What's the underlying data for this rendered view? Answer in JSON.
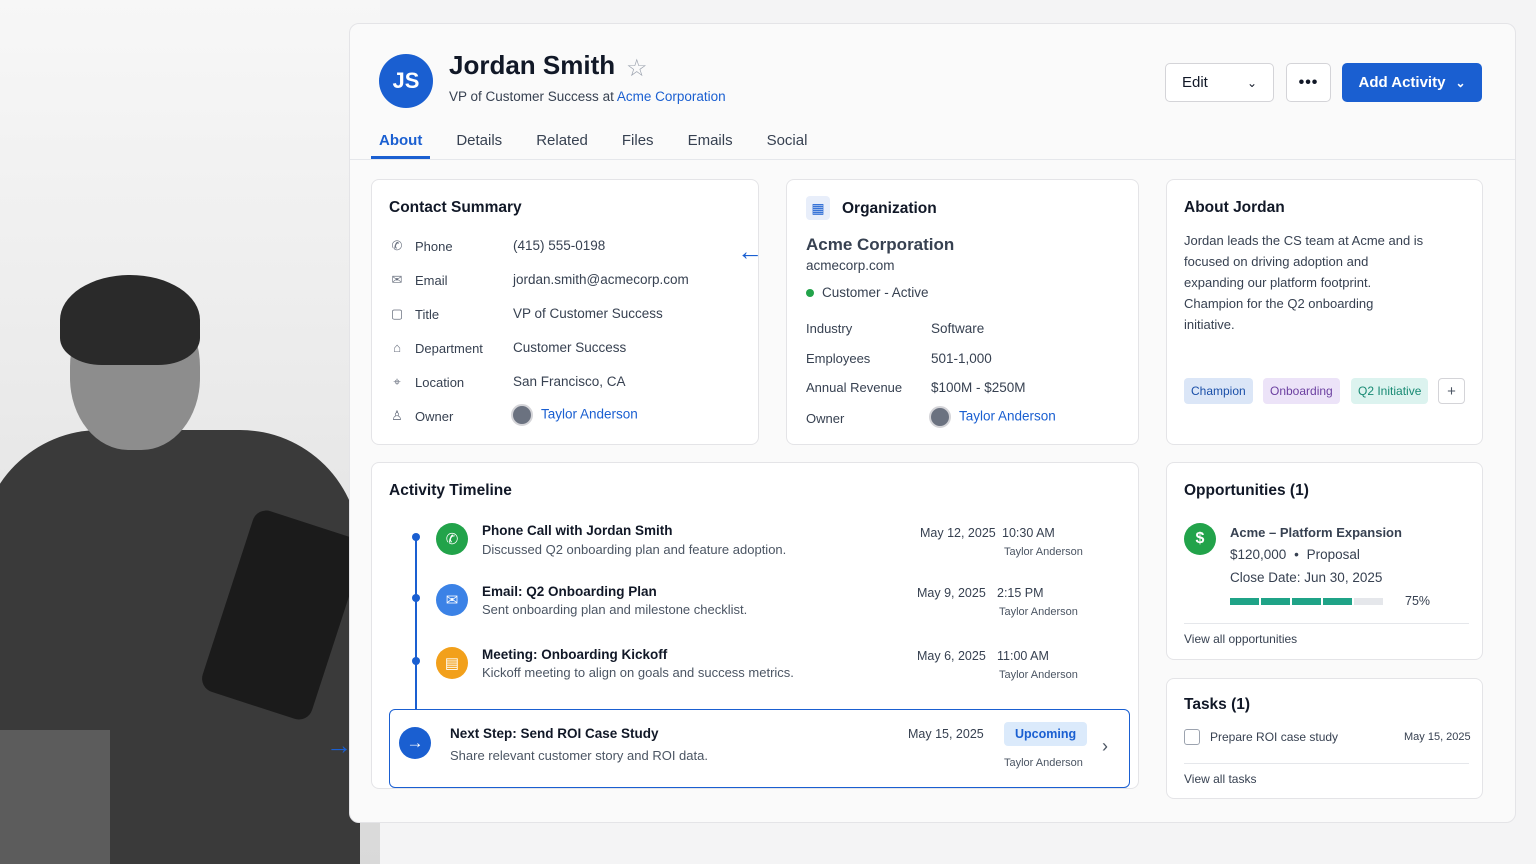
{
  "contact": {
    "initials": "JS",
    "name": "Jordan Smith",
    "role_prefix": "VP of Customer Success at",
    "company": "Acme Corporation"
  },
  "header_actions": {
    "edit_label": "Edit",
    "more_label": "•••",
    "add_activity_label": "Add Activity"
  },
  "tabs": [
    "About",
    "Details",
    "Related",
    "Files",
    "Emails",
    "Social"
  ],
  "contact_summary": {
    "title": "Contact Summary",
    "fields": [
      {
        "label": "Phone",
        "value": "(415) 555-0198",
        "icon": "phone-icon"
      },
      {
        "label": "Email",
        "value": "jordan.smith@acmecorp.com",
        "icon": "mail-icon"
      },
      {
        "label": "Title",
        "value": "VP of Customer Success",
        "icon": "clipboard-icon"
      },
      {
        "label": "Department",
        "value": "Customer Success",
        "icon": "bank-icon"
      },
      {
        "label": "Location",
        "value": "San Francisco, CA",
        "icon": "location-pin-icon"
      },
      {
        "label": "Owner",
        "value": "Taylor Anderson",
        "icon": "user-icon"
      }
    ]
  },
  "organization": {
    "title": "Organization",
    "name": "Acme Corporation",
    "website": "acmecorp.com",
    "status": "Customer - Active",
    "fields": [
      {
        "label": "Industry",
        "value": "Software"
      },
      {
        "label": "Employees",
        "value": "501-1,000"
      },
      {
        "label": "Annual Revenue",
        "value": "$100M - $250M"
      },
      {
        "label": "Owner",
        "value": "Taylor Anderson"
      }
    ]
  },
  "about": {
    "title": "About Jordan",
    "lines": [
      "Jordan leads the CS team at Acme and is",
      "focused on driving adoption and",
      "expanding our platform footprint.",
      "Champion for the Q2 onboarding",
      "initiative."
    ],
    "tags": [
      {
        "label": "Champion",
        "bg": "#dbe6f7",
        "fg": "#1a4fa8"
      },
      {
        "label": "Onboarding",
        "bg": "#ece3f8",
        "fg": "#6b3fa0"
      },
      {
        "label": "Q2 Initiative",
        "bg": "#dcf3ef",
        "fg": "#178a73"
      }
    ],
    "add_tag": "+"
  },
  "timeline": {
    "title": "Activity Timeline",
    "items": [
      {
        "title": "Phone Call with Jordan Smith",
        "desc": "Discussed Q2 onboarding plan and feature adoption.",
        "date": "May 12, 2025",
        "time": "10:30 AM",
        "owner": "Taylor Anderson",
        "icon": "phone-icon",
        "color": "#22a34a"
      },
      {
        "title": "Email: Q2 Onboarding Plan",
        "desc": "Sent onboarding plan and milestone checklist.",
        "date": "May 9, 2025",
        "time": "2:15 PM",
        "owner": "Taylor Anderson",
        "icon": "mail-icon",
        "color": "#3b82e6"
      },
      {
        "title": "Meeting: Onboarding Kickoff",
        "desc": "Kickoff meeting to align on goals and success metrics.",
        "date": "May 6, 2025",
        "time": "11:00 AM",
        "owner": "Taylor Anderson",
        "icon": "calendar-icon",
        "color": "#f2a01b"
      }
    ],
    "next_step": {
      "title": "Next Step: Send ROI Case Study",
      "desc": "Share relevant customer story and ROI data.",
      "date": "May 15, 2025",
      "badge": "Upcoming",
      "owner": "Taylor Anderson"
    }
  },
  "opportunities": {
    "title": "Opportunities (1)",
    "name": "Acme – Platform Expansion",
    "amount": "$120,000",
    "separator": "•",
    "stage": "Proposal",
    "close_date": "Close Date: Jun 30, 2025",
    "progress_percent": 75,
    "progress_label": "75%",
    "view_all": "View all opportunities"
  },
  "tasks": {
    "title": "Tasks (1)",
    "items": [
      {
        "label": "Prepare ROI case study",
        "date": "May 15, 2025",
        "done": false
      }
    ],
    "view_all": "View all tasks"
  },
  "colors": {
    "accent": "#1a5fd1",
    "success": "#22a34a",
    "progress": "#1fa387"
  }
}
